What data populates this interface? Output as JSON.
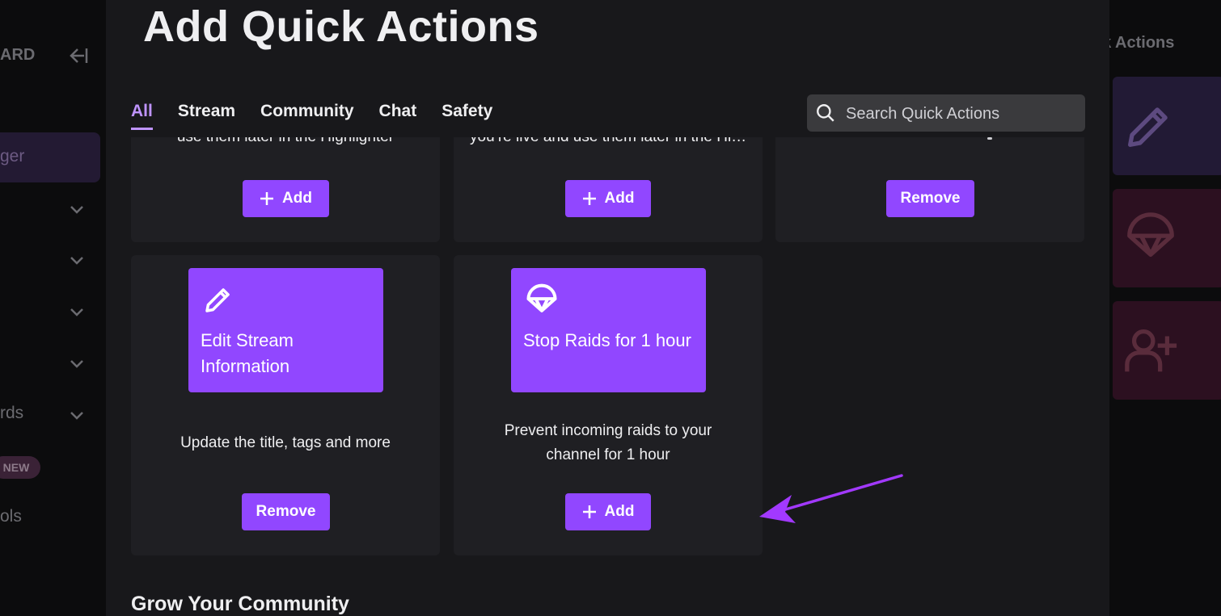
{
  "background": {
    "left_nav": {
      "dashboard_fragment": "ARD",
      "active_item_fragment": "ger",
      "rewards_fragment": "rds",
      "new_badge": "NEW",
      "tools_fragment": "ols"
    },
    "right_panel": {
      "header_fragment": "ck Actions"
    }
  },
  "modal": {
    "title": "Add Quick Actions",
    "tabs": [
      {
        "label": "All",
        "active": true
      },
      {
        "label": "Stream",
        "active": false
      },
      {
        "label": "Community",
        "active": false
      },
      {
        "label": "Chat",
        "active": false
      },
      {
        "label": "Safety",
        "active": false
      }
    ],
    "search": {
      "placeholder": "Search Quick Actions",
      "icon": "search-icon"
    },
    "cards": [
      {
        "description": "use them later in the Highlighter",
        "button": "Add",
        "button_icon": "plus-icon"
      },
      {
        "description": "you’re live and use them later in the Highlighter",
        "button": "Add",
        "button_icon": "plus-icon"
      },
      {
        "description": "",
        "button": "Remove"
      },
      {
        "tile_title": "Edit Stream Information",
        "tile_icon": "pencil-icon",
        "description": "Update the title, tags and more",
        "button": "Remove"
      },
      {
        "tile_title": "Stop Raids for 1 hour",
        "tile_icon": "parachute-icon",
        "description_lines": [
          "Prevent incoming raids to your",
          "channel for 1 hour"
        ],
        "button": "Add",
        "button_icon": "plus-icon"
      }
    ],
    "section_heading": "Grow Your Community"
  },
  "colors": {
    "accent": "#9147ff",
    "active_tab": "#bf94ff",
    "modal_bg": "#18181b",
    "card_bg": "#1f1f23",
    "annotation_arrow": "#a239ff"
  }
}
